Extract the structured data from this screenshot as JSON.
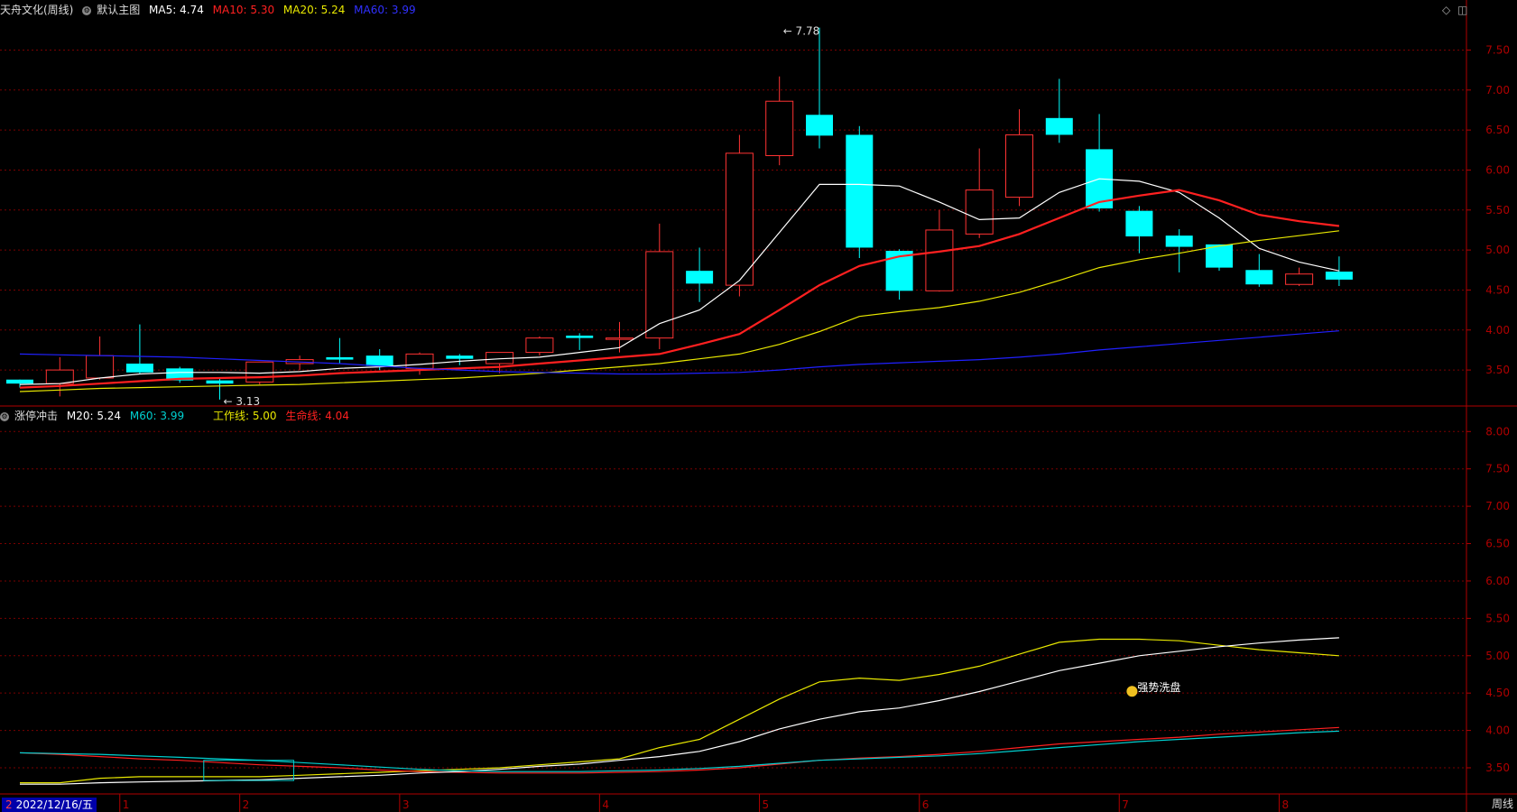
{
  "top_header": {
    "title": "天舟文化(周线)",
    "main_chart": "默认主图",
    "ma5_label": "MA5:",
    "ma5_value": "4.74",
    "ma10_label": "MA10:",
    "ma10_value": "5.30",
    "ma20_label": "MA20:",
    "ma20_value": "5.24",
    "ma60_label": "MA60:",
    "ma60_value": "3.99"
  },
  "bottom_header": {
    "name": "涨停冲击",
    "m20_label": "M20:",
    "m20_value": "5.24",
    "m60_label": "M60:",
    "m60_value": "3.99",
    "work_label": "工作线:",
    "work_value": "5.00",
    "life_label": "生命线:",
    "life_value": "4.04"
  },
  "footer": {
    "date": "2022/12/16/五",
    "period": "周线",
    "start_marker": "2"
  },
  "colors": {
    "bg": "#000000",
    "grid": "#7a0000",
    "axis": "#b00000",
    "up": "#ff3333",
    "down": "#00ffff",
    "ma5": "#ffffff",
    "ma10": "#ff2020",
    "ma20": "#e8e800",
    "ma60": "#2020ff",
    "work": "#e8e800",
    "life": "#ff2020",
    "m20": "#ffffff",
    "m60": "#00d0d0"
  },
  "chart_data": {
    "type": "candlestick",
    "x_ticks": [
      "1",
      "2",
      "3",
      "4",
      "5",
      "6",
      "7",
      "8"
    ],
    "top_panel": {
      "y_ticks": [
        "3.50",
        "4.00",
        "4.50",
        "5.00",
        "5.50",
        "6.00",
        "6.50",
        "7.00",
        "7.50"
      ],
      "ylim": [
        3.05,
        7.9
      ],
      "annotations": [
        {
          "text": "7.78",
          "bar": 19,
          "value": 7.78
        },
        {
          "text": "3.13",
          "bar": 5,
          "value": 3.13
        }
      ],
      "candles": [
        {
          "o": 3.38,
          "h": 3.38,
          "l": 3.28,
          "c": 3.33
        },
        {
          "o": 3.33,
          "h": 3.66,
          "l": 3.17,
          "c": 3.5
        },
        {
          "o": 3.4,
          "h": 3.92,
          "l": 3.38,
          "c": 3.68
        },
        {
          "o": 3.58,
          "h": 4.07,
          "l": 3.45,
          "c": 3.47
        },
        {
          "o": 3.52,
          "h": 3.54,
          "l": 3.34,
          "c": 3.37
        },
        {
          "o": 3.37,
          "h": 3.4,
          "l": 3.13,
          "c": 3.33
        },
        {
          "o": 3.35,
          "h": 3.6,
          "l": 3.32,
          "c": 3.6
        },
        {
          "o": 3.58,
          "h": 3.68,
          "l": 3.5,
          "c": 3.63
        },
        {
          "o": 3.66,
          "h": 3.9,
          "l": 3.58,
          "c": 3.63
        },
        {
          "o": 3.68,
          "h": 3.76,
          "l": 3.5,
          "c": 3.55
        },
        {
          "o": 3.52,
          "h": 3.72,
          "l": 3.44,
          "c": 3.7
        },
        {
          "o": 3.68,
          "h": 3.7,
          "l": 3.56,
          "c": 3.64
        },
        {
          "o": 3.58,
          "h": 3.72,
          "l": 3.46,
          "c": 3.72
        },
        {
          "o": 3.72,
          "h": 3.92,
          "l": 3.68,
          "c": 3.9
        },
        {
          "o": 3.93,
          "h": 3.96,
          "l": 3.75,
          "c": 3.9
        },
        {
          "o": 3.9,
          "h": 4.1,
          "l": 3.72,
          "c": 3.9
        },
        {
          "o": 3.9,
          "h": 5.33,
          "l": 3.76,
          "c": 4.98
        },
        {
          "o": 4.74,
          "h": 5.03,
          "l": 4.35,
          "c": 4.58
        },
        {
          "o": 4.56,
          "h": 6.44,
          "l": 4.42,
          "c": 6.21
        },
        {
          "o": 6.18,
          "h": 7.17,
          "l": 6.06,
          "c": 6.86
        },
        {
          "o": 6.69,
          "h": 7.78,
          "l": 6.27,
          "c": 6.43
        },
        {
          "o": 6.44,
          "h": 6.55,
          "l": 4.9,
          "c": 5.03
        },
        {
          "o": 4.99,
          "h": 5.01,
          "l": 4.38,
          "c": 4.49
        },
        {
          "o": 4.49,
          "h": 5.5,
          "l": 4.48,
          "c": 5.25
        },
        {
          "o": 5.2,
          "h": 6.27,
          "l": 5.15,
          "c": 5.75
        },
        {
          "o": 5.66,
          "h": 6.76,
          "l": 5.55,
          "c": 6.44
        },
        {
          "o": 6.65,
          "h": 7.14,
          "l": 6.34,
          "c": 6.44
        },
        {
          "o": 6.26,
          "h": 6.7,
          "l": 5.48,
          "c": 5.52
        },
        {
          "o": 5.49,
          "h": 5.55,
          "l": 4.96,
          "c": 5.17
        },
        {
          "o": 5.18,
          "h": 5.26,
          "l": 4.72,
          "c": 5.04
        },
        {
          "o": 5.07,
          "h": 5.07,
          "l": 4.74,
          "c": 4.78
        },
        {
          "o": 4.75,
          "h": 4.95,
          "l": 4.54,
          "c": 4.57
        },
        {
          "o": 4.57,
          "h": 4.78,
          "l": 4.55,
          "c": 4.7
        },
        {
          "o": 4.73,
          "h": 4.92,
          "l": 4.55,
          "c": 4.63
        }
      ],
      "series": [
        {
          "name": "MA5",
          "values": [
            3.32,
            3.33,
            3.4,
            3.45,
            3.47,
            3.47,
            3.46,
            3.48,
            3.52,
            3.54,
            3.57,
            3.61,
            3.64,
            3.66,
            3.72,
            3.78,
            4.08,
            4.25,
            4.62,
            5.22,
            5.82,
            5.82,
            5.8,
            5.6,
            5.38,
            5.4,
            5.72,
            5.89,
            5.86,
            5.72,
            5.4,
            5.02,
            4.85,
            4.74
          ]
        },
        {
          "name": "MA10",
          "values": [
            3.28,
            3.3,
            3.33,
            3.36,
            3.39,
            3.4,
            3.41,
            3.43,
            3.46,
            3.48,
            3.5,
            3.52,
            3.54,
            3.58,
            3.62,
            3.66,
            3.7,
            3.82,
            3.95,
            4.25,
            4.56,
            4.8,
            4.92,
            4.98,
            5.05,
            5.2,
            5.4,
            5.6,
            5.68,
            5.75,
            5.62,
            5.44,
            5.36,
            5.3
          ]
        },
        {
          "name": "MA20",
          "values": [
            3.23,
            3.25,
            3.27,
            3.28,
            3.29,
            3.3,
            3.31,
            3.32,
            3.34,
            3.36,
            3.38,
            3.4,
            3.43,
            3.46,
            3.5,
            3.54,
            3.58,
            3.64,
            3.7,
            3.82,
            3.98,
            4.17,
            4.23,
            4.28,
            4.36,
            4.47,
            4.62,
            4.78,
            4.88,
            4.96,
            5.05,
            5.12,
            5.18,
            5.24
          ]
        },
        {
          "name": "MA60",
          "values": [
            3.7,
            3.69,
            3.68,
            3.67,
            3.66,
            3.64,
            3.62,
            3.6,
            3.58,
            3.55,
            3.52,
            3.5,
            3.48,
            3.47,
            3.46,
            3.45,
            3.45,
            3.46,
            3.47,
            3.5,
            3.54,
            3.57,
            3.59,
            3.61,
            3.63,
            3.66,
            3.7,
            3.75,
            3.79,
            3.83,
            3.87,
            3.91,
            3.95,
            3.99
          ]
        }
      ]
    },
    "bottom_panel": {
      "y_ticks": [
        "3.50",
        "4.00",
        "4.50",
        "5.00",
        "5.50",
        "6.00",
        "6.50",
        "7.00",
        "7.50",
        "8.00"
      ],
      "ylim": [
        3.15,
        8.1
      ],
      "annotation": {
        "text": "强势洗盘",
        "bar": 28,
        "value": 4.62
      },
      "series": [
        {
          "name": "工作线",
          "values": [
            3.3,
            3.3,
            3.36,
            3.38,
            3.38,
            3.38,
            3.38,
            3.4,
            3.42,
            3.44,
            3.46,
            3.48,
            3.5,
            3.54,
            3.58,
            3.62,
            3.77,
            3.88,
            4.15,
            4.42,
            4.65,
            4.7,
            4.67,
            4.75,
            4.86,
            5.02,
            5.18,
            5.22,
            5.22,
            5.2,
            5.14,
            5.08,
            5.04,
            5.0
          ]
        },
        {
          "name": "生命线",
          "values": [
            3.7,
            3.68,
            3.65,
            3.62,
            3.6,
            3.57,
            3.54,
            3.52,
            3.5,
            3.47,
            3.45,
            3.44,
            3.43,
            3.43,
            3.43,
            3.44,
            3.45,
            3.47,
            3.5,
            3.55,
            3.6,
            3.63,
            3.65,
            3.68,
            3.72,
            3.77,
            3.82,
            3.85,
            3.88,
            3.91,
            3.95,
            3.98,
            4.01,
            4.04
          ]
        },
        {
          "name": "M20",
          "values": [
            3.28,
            3.28,
            3.3,
            3.31,
            3.32,
            3.33,
            3.34,
            3.36,
            3.38,
            3.4,
            3.43,
            3.45,
            3.48,
            3.52,
            3.55,
            3.6,
            3.65,
            3.72,
            3.85,
            4.02,
            4.15,
            4.25,
            4.3,
            4.4,
            4.52,
            4.66,
            4.8,
            4.9,
            5.0,
            5.06,
            5.12,
            5.17,
            5.21,
            5.24
          ]
        },
        {
          "name": "M60",
          "values": [
            3.7,
            3.69,
            3.68,
            3.66,
            3.64,
            3.62,
            3.6,
            3.57,
            3.54,
            3.51,
            3.48,
            3.46,
            3.45,
            3.45,
            3.45,
            3.46,
            3.47,
            3.49,
            3.52,
            3.56,
            3.6,
            3.62,
            3.64,
            3.66,
            3.69,
            3.73,
            3.77,
            3.81,
            3.85,
            3.88,
            3.91,
            3.94,
            3.97,
            3.99
          ]
        }
      ]
    }
  }
}
